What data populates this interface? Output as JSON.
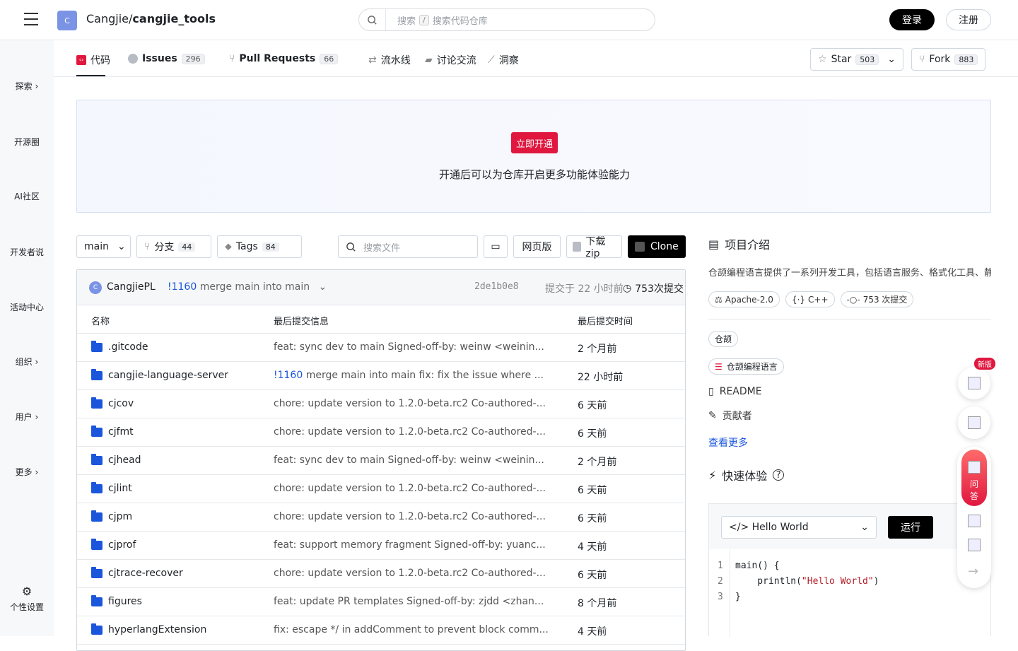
{
  "header": {
    "avatar_letter": "C",
    "repo_owner": "Cangjie/",
    "repo_name": "cangjie_tools",
    "search_placeholder_a": "搜索",
    "search_kbd": "/",
    "search_placeholder_b": "搜索代码仓库",
    "login": "登录",
    "register": "注册"
  },
  "leftnav": {
    "items": [
      "探索",
      "开源圈",
      "AI社区",
      "开发者说",
      "活动中心",
      "组织",
      "用户",
      "更多"
    ],
    "settings": "个性设置"
  },
  "tabs": {
    "code": "代码",
    "issues": "Issues",
    "issues_count": "296",
    "prs": "Pull Requests",
    "prs_count": "66",
    "pipeline": "流水线",
    "discussions": "讨论交流",
    "insights": "洞察",
    "star": "Star",
    "star_count": "503",
    "fork": "Fork",
    "fork_count": "883"
  },
  "banner": {
    "button": "立即开通",
    "text": "开通后可以为仓库开启更多功能体验能力"
  },
  "toolbar": {
    "branch": "main",
    "branches_label": "分支",
    "branches_count": "44",
    "tags_label": "Tags",
    "tags_count": "84",
    "file_search_placeholder": "搜索文件",
    "webide": "网页版",
    "download": "下载zip",
    "clone": "Clone"
  },
  "last_commit": {
    "avatar_letter": "C",
    "author": "CangjiePL",
    "pr": "!1160",
    "message": "merge main into main",
    "hash": "2de1b0e8",
    "time": "提交于 22 小时前",
    "commits": "753次提交"
  },
  "file_table": {
    "headers": [
      "名称",
      "最后提交信息",
      "最后提交时间"
    ],
    "rows": [
      {
        "name": ".gitcode",
        "pr": "",
        "commit": "feat: sync dev to main Signed-off-by: weinw <weinin...",
        "time": "2 个月前"
      },
      {
        "name": "cangjie-language-server",
        "pr": "!1160",
        "commit": " merge main into main fix: fix the issue where ...",
        "time": "22 小时前"
      },
      {
        "name": "cjcov",
        "pr": "",
        "commit": "chore: update version to 1.2.0-beta.rc2 Co-authored-...",
        "time": "6 天前"
      },
      {
        "name": "cjfmt",
        "pr": "",
        "commit": "chore: update version to 1.2.0-beta.rc2 Co-authored-...",
        "time": "6 天前"
      },
      {
        "name": "cjhead",
        "pr": "",
        "commit": "feat: sync dev to main Signed-off-by: weinw <weinin...",
        "time": "2 个月前"
      },
      {
        "name": "cjlint",
        "pr": "",
        "commit": "chore: update version to 1.2.0-beta.rc2 Co-authored-...",
        "time": "6 天前"
      },
      {
        "name": "cjpm",
        "pr": "",
        "commit": "chore: update version to 1.2.0-beta.rc2 Co-authored-...",
        "time": "6 天前"
      },
      {
        "name": "cjprof",
        "pr": "",
        "commit": "feat: support memory fragment Signed-off-by: yuanc...",
        "time": "4 天前"
      },
      {
        "name": "cjtrace-recover",
        "pr": "",
        "commit": "chore: update version to 1.2.0-beta.rc2 Co-authored-...",
        "time": "6 天前"
      },
      {
        "name": "figures",
        "pr": "",
        "commit": "feat: update PR templates Signed-off-by: zjdd <zhan...",
        "time": "8 个月前"
      },
      {
        "name": "hyperlangExtension",
        "pr": "",
        "commit": "fix: escape */ in addComment to prevent block comm...",
        "time": "4 天前"
      }
    ]
  },
  "sidebar": {
    "title": "项目介绍",
    "description": "仓颉编程语言提供了一系列开发工具，包括语言服务、格式化工具、静态检查工具、包管理工具等，为开发者提供",
    "license": "Apache-2.0",
    "language": "C++",
    "commits": "753 次提交",
    "topic": "仓颉",
    "tag": "仓颉编程语言",
    "readme": "README",
    "changelog": "贡献者",
    "more_link": "查看更多",
    "quick_title": "快速体验"
  },
  "codebox": {
    "example": "</> Hello World",
    "run": "运行",
    "lines": [
      "main() {",
      "    println(",
      "}"
    ],
    "string_literal": "\"Hello World\"",
    "line_end": ")"
  },
  "floating": {
    "new_badge": "新版",
    "ai_label_1": "问",
    "ai_label_2": "答"
  }
}
